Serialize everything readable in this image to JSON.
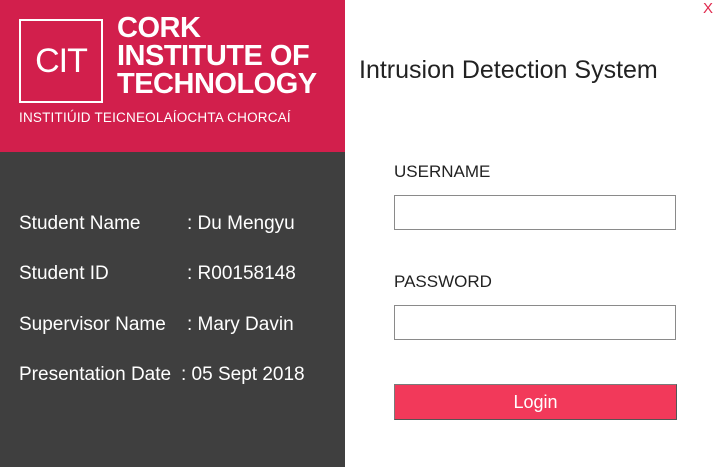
{
  "colors": {
    "brand": "#d21f4c",
    "info_panel_bg": "#3f3f3f",
    "login_button": "#f2395a",
    "close_icon": "#e02a4e"
  },
  "logo": {
    "abbrev": "CIT",
    "name_lines": [
      "CORK",
      "INSTITUTE OF",
      "TECHNOLOGY"
    ],
    "irish_name": "INSTITIÚID TEICNEOLAÍOCHTA CHORCAÍ"
  },
  "info": {
    "rows": [
      {
        "label": "Student Name",
        "value": ": Du Mengyu"
      },
      {
        "label": "Student ID",
        "value": ": R00158148"
      },
      {
        "label": "Supervisor Name",
        "value": ": Mary Davin"
      },
      {
        "label": "Presentation Date",
        "value": ": 05 Sept 2018"
      }
    ]
  },
  "window": {
    "close_label": "X",
    "close_icon": "close-icon"
  },
  "form": {
    "title": "Intrusion Detection System",
    "username_label": "USERNAME",
    "username_value": "",
    "password_label": "PASSWORD",
    "password_value": "",
    "login_label": "Login"
  }
}
